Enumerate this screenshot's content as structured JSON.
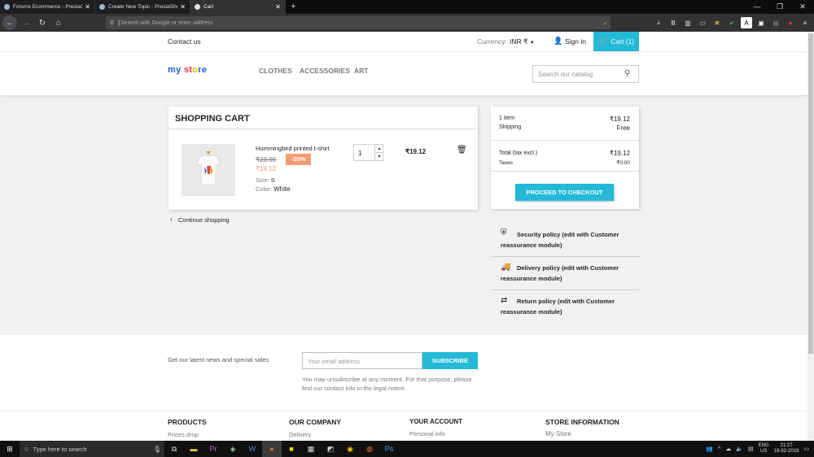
{
  "browser": {
    "tabs": [
      {
        "title": "Forums Ecommerce - PrestaSh",
        "active": false
      },
      {
        "title": "Create New Topic - PrestaShop",
        "active": false
      },
      {
        "title": "Cart",
        "active": true
      }
    ],
    "new_tab": "+",
    "url_placeholder": "Search with Google or enter address"
  },
  "store": {
    "contact": "Contact us",
    "currency_label": "Currency:",
    "currency_value": "INR ₹",
    "sign_in": "Sign in",
    "cart": "Cart (1)",
    "logo": "my store",
    "menu": [
      "CLOTHES",
      "ACCESSORIES",
      "ART"
    ],
    "search_placeholder": "Search our catalog"
  },
  "cart": {
    "heading": "SHOPPING CART",
    "product": {
      "name": "Hummingbird printed t-shirt",
      "old_price": "₹23.90",
      "discount": "-20%",
      "price": "₹19.12",
      "size_label": "Size:",
      "size": "S",
      "color_label": "Color:",
      "color": "White",
      "qty": "1",
      "total": "₹19.12"
    },
    "continue": "Continue shopping"
  },
  "summary": {
    "items_label": "1 item",
    "items_value": "₹19.12",
    "shipping_label": "Shipping",
    "shipping_value": "Free",
    "total_label": "Total (tax excl.)",
    "total_value": "₹19.12",
    "taxes_label": "Taxes",
    "taxes_value": "₹0.00",
    "checkout": "PROCEED TO CHECKOUT"
  },
  "reassurance": [
    "Security policy (edit with Customer reassurance module)",
    "Delivery policy (edit with Customer reassurance module)",
    "Return policy (edit with Customer reassurance module)"
  ],
  "newsletter": {
    "label": "Get our latest news and special sales",
    "placeholder": "Your email address",
    "button": "SUBSCRIBE",
    "note": "You may unsubscribe at any moment. For that purpose, please find our contact info in the legal notice."
  },
  "footer": {
    "products_title": "PRODUCTS",
    "products_item": "Prices drop",
    "company_title": "OUR COMPANY",
    "company_item": "Delivery",
    "account_title": "YOUR ACCOUNT",
    "account_item": "Personal info",
    "info_title": "STORE INFORMATION",
    "info_item": "My Store"
  },
  "taskbar": {
    "search_placeholder": "Type here to search",
    "lang": "ENG",
    "region": "US",
    "time": "21:27",
    "date": "19-02-2019"
  },
  "colors": {
    "accent": "#24b9d7",
    "discount": "#f39d72",
    "price": "#f39d72"
  }
}
